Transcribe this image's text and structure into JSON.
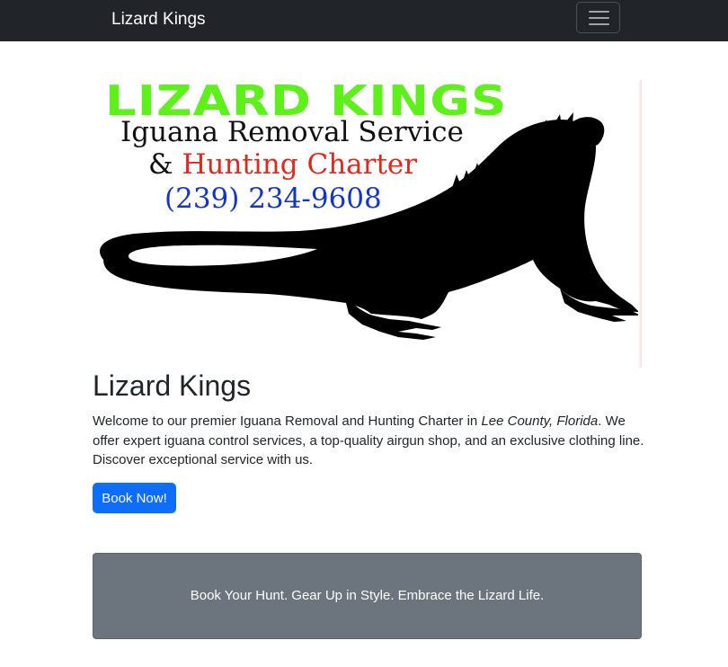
{
  "navbar": {
    "brand": "Lizard Kings",
    "toggler_icon": "hamburger-menu-icon",
    "background": "#212529"
  },
  "hero_image": {
    "logo_title": "LIZARD KINGS",
    "line1": "Iguana Removal Service",
    "line2_amp": "&",
    "line2_text": "Hunting Charter",
    "phone": "(239) 234-9608",
    "colors": {
      "title": "#5ef01a",
      "line2_text": "#e0291b",
      "phone": "#1436c4"
    }
  },
  "main": {
    "title": "Lizard Kings",
    "intro_before": "Welcome to our premier Iguana Removal and Hunting Charter in ",
    "intro_location": "Lee County, Florida",
    "intro_after": ". We offer expert iguana control services, a top-quality airgun shop, and an exclusive clothing line. Discover exceptional service with us.",
    "book_button": "Book Now!",
    "book_button_color": "#0d6efd"
  },
  "banner": {
    "text": "Book Your Hunt. Gear Up in Style. Embrace the Lizard Life.",
    "background": "#6c757d"
  }
}
